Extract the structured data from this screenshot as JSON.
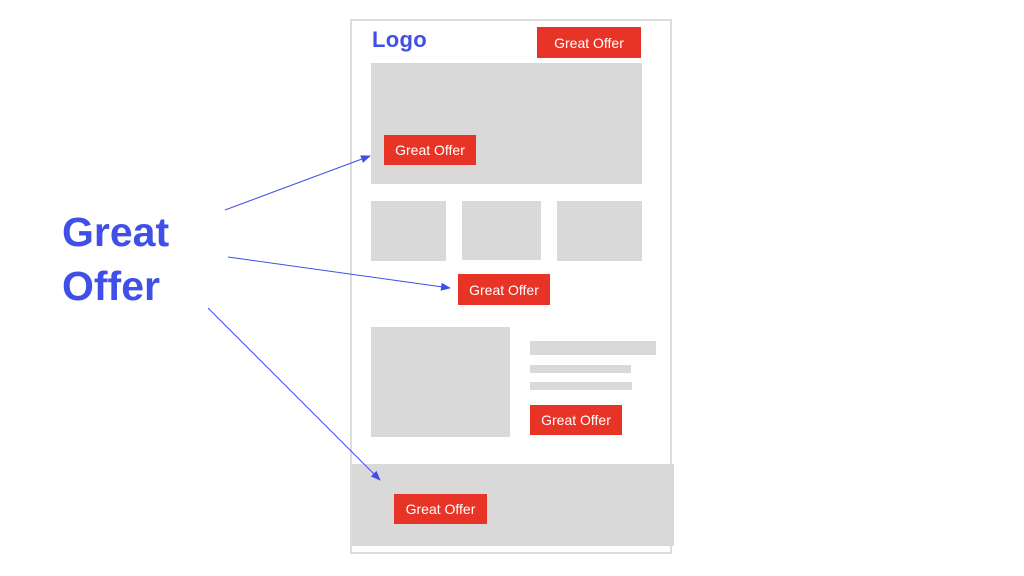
{
  "annotation": {
    "label_line1": "Great",
    "label_line2": "Offer",
    "color": "#3f4fe8"
  },
  "wireframe": {
    "logo": "Logo",
    "header_cta": "Great Offer",
    "hero_cta": "Great Offer",
    "middle_cta": "Great Offer",
    "feature_cta": "Great Offer",
    "footer_cta": "Great Offer",
    "cta_color": "#e83426",
    "placeholder_color": "#d9d9d9"
  }
}
